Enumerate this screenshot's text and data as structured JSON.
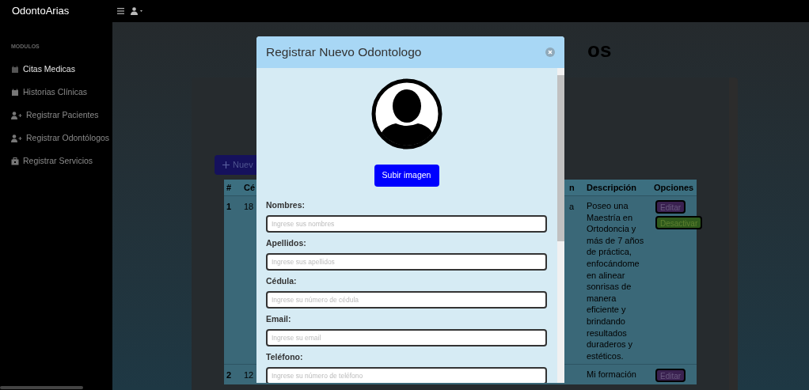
{
  "topbar": {
    "brand": "OdontoArias"
  },
  "sidebar": {
    "heading": "MODULOS",
    "items": [
      {
        "label": "Citas Medicas",
        "kind": "calendar",
        "selected": true
      },
      {
        "label": "Historias Clínicas",
        "kind": "calendar",
        "selected": false
      },
      {
        "label": "Registrar Pacientes",
        "kind": "user-plus",
        "selected": false
      },
      {
        "label": "Registrar Odontólogos",
        "kind": "user-plus",
        "selected": false
      },
      {
        "label": "Registrar Servicios",
        "kind": "briefcase",
        "selected": false
      }
    ]
  },
  "page": {
    "title": "os",
    "new_button": "Nuev",
    "table": {
      "columns": [
        "#",
        "Cé",
        "n",
        "Descripción",
        "Opciones"
      ],
      "rows": [
        {
          "cells": [
            "1",
            "18",
            "a",
            "Poseo una Maestría en Ortodoncia y más de 7 años de práctica, enfocándome en alinear sonrisas de manera eficiente y brindando resultados duraderos y estéticos."
          ],
          "actions": [
            "Editar",
            "Desactivar"
          ]
        },
        {
          "cells": [
            "2",
            "12",
            "",
            "Mi formación"
          ],
          "actions": [
            "Editar"
          ]
        }
      ]
    }
  },
  "modal": {
    "title": "Registrar Nuevo Odontologo",
    "upload_button": "Subir imagen",
    "fields": [
      {
        "label": "Nombres:",
        "placeholder": "Ingrese sus nombres"
      },
      {
        "label": "Apellidos:",
        "placeholder": "Ingrese sus apellidos"
      },
      {
        "label": "Cédula:",
        "placeholder": "Ingrese su número de cédula"
      },
      {
        "label": "Email:",
        "placeholder": "Ingrese su email"
      },
      {
        "label": "Teléfono:",
        "placeholder": "Ingrese su número de teléfono"
      }
    ]
  }
}
